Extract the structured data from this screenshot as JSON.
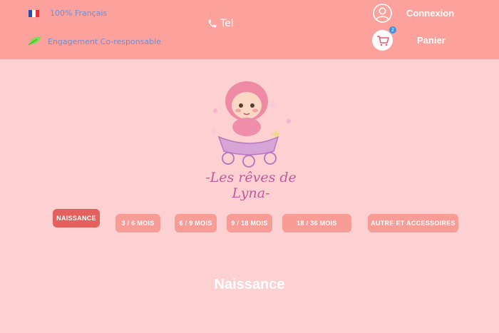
{
  "header": {
    "made_in_france": "100% Français",
    "eco_engagement": "Engagement Co-responsable",
    "tel_label": "Tel",
    "account_label": "Connexion",
    "cart_label": "Panier",
    "cart_count": "2"
  },
  "brand": {
    "name": "-Les rêves de Lyna-"
  },
  "nav": {
    "items": [
      {
        "label": "NAISSANCE",
        "active": true
      },
      {
        "label": "3 / 6 MOIS",
        "active": false
      },
      {
        "label": "6 / 9 MOIS",
        "active": false
      },
      {
        "label": "9 / 18 MOIS",
        "active": false
      },
      {
        "label": "18 / 36 MOIS",
        "active": false
      },
      {
        "label": "AUTRE ET ACCESSOIRES",
        "active": false
      }
    ]
  },
  "main": {
    "section_title": "Naissance"
  },
  "colors": {
    "header_bg": "#fca19b",
    "page_bg": "#fdd1d1",
    "nav_button": "#f89c98",
    "nav_button_active": "#e4605d",
    "info_text": "#6f8fd4"
  },
  "icons": {
    "flag": "france-flag-icon",
    "leaf": "leaf-icon",
    "phone": "phone-icon",
    "account": "user-circle-icon",
    "cart": "cart-icon"
  }
}
